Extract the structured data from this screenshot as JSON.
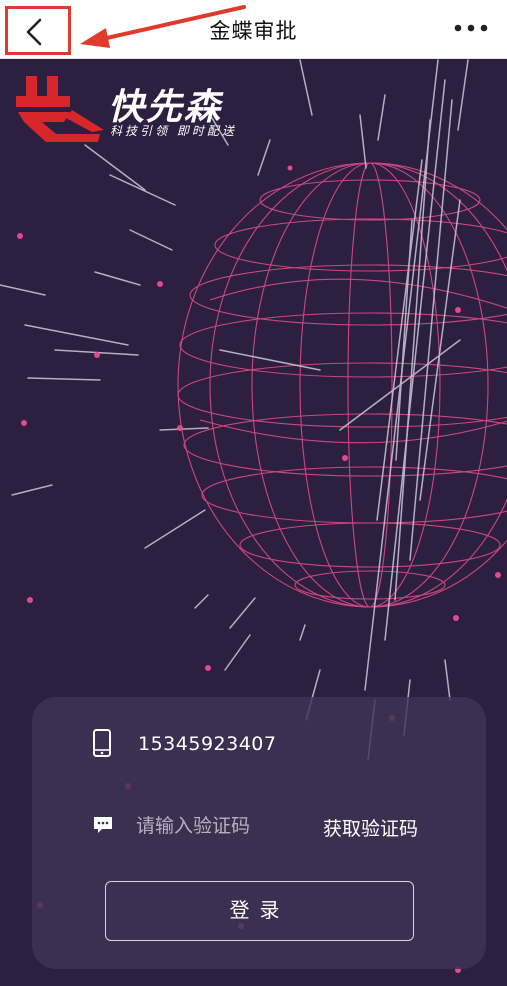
{
  "nav": {
    "title": "金蝶审批",
    "back_icon": "chevron-left-icon",
    "more_icon": "more-dots-icon"
  },
  "logo": {
    "name": "快先森",
    "slogan": "科技引领 即时配送"
  },
  "login": {
    "phone_value": "15345923407",
    "code_placeholder": "请输入验证码",
    "get_code_label": "获取验证码",
    "submit_label": "登录"
  },
  "colors": {
    "annotation": "#e03a2e",
    "background": "#2c1f3f",
    "globe": "#d44a86",
    "accent": "#e24a8c"
  }
}
